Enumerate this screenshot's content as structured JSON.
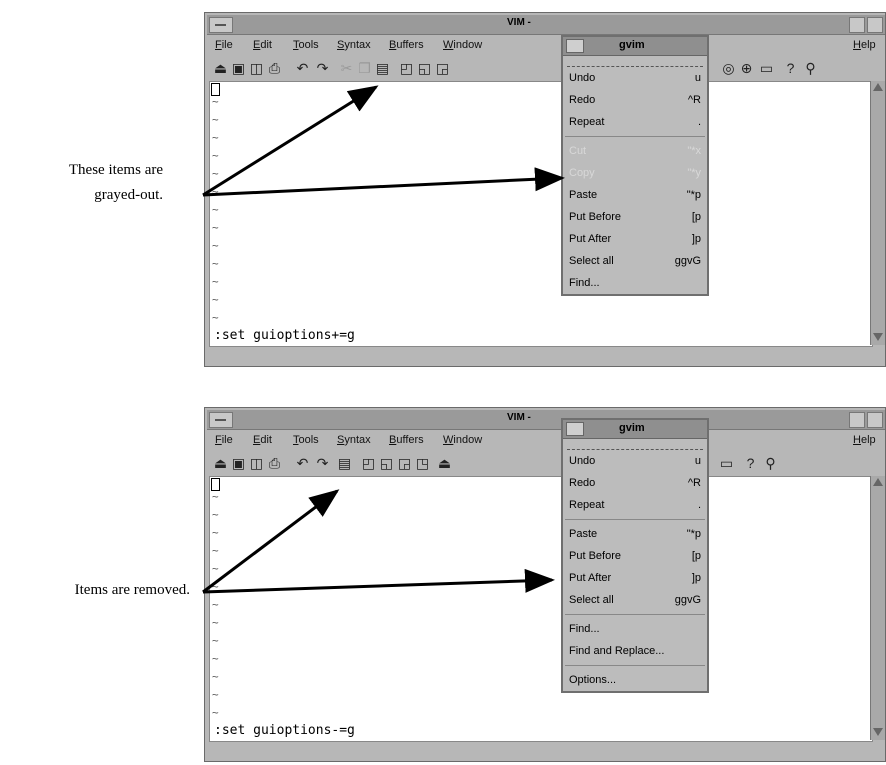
{
  "top": {
    "caption_line1": "These items are",
    "caption_line2": "grayed-out.",
    "window_title": "VIM -",
    "menus": [
      {
        "pre": "",
        "acc": "F",
        "post": "ile"
      },
      {
        "pre": "",
        "acc": "E",
        "post": "dit"
      },
      {
        "pre": "",
        "acc": "T",
        "post": "ools"
      },
      {
        "pre": "",
        "acc": "S",
        "post": "yntax"
      },
      {
        "pre": "",
        "acc": "B",
        "post": "uffers"
      },
      {
        "pre": "",
        "acc": "W",
        "post": "indow"
      },
      {
        "pre": "",
        "acc": "H",
        "post": "elp"
      }
    ],
    "menu_title": "gvim",
    "menu_items": [
      {
        "label": "Undo",
        "shortcut": "u",
        "grayed": false
      },
      {
        "label": "Redo",
        "shortcut": "^R",
        "grayed": false
      },
      {
        "label": "Repeat",
        "shortcut": ".",
        "grayed": false
      },
      {
        "label": "Cut",
        "shortcut": "\"*x",
        "grayed": true
      },
      {
        "label": "Copy",
        "shortcut": "\"*y",
        "grayed": true
      },
      {
        "label": "Paste",
        "shortcut": "\"*p",
        "grayed": false
      },
      {
        "label": "Put Before",
        "shortcut": "[p",
        "grayed": false
      },
      {
        "label": "Put After",
        "shortcut": "]p",
        "grayed": false
      },
      {
        "label": "Select all",
        "shortcut": "ggvG",
        "grayed": false
      },
      {
        "label": "Find...",
        "shortcut": "",
        "grayed": false
      }
    ],
    "command_line": ":set guioptions+=g"
  },
  "bottom": {
    "caption": "Items are removed.",
    "window_title": "VIM -",
    "menu_title": "gvim",
    "menu_items": [
      {
        "label": "Undo",
        "shortcut": "u"
      },
      {
        "label": "Redo",
        "shortcut": "^R"
      },
      {
        "label": "Repeat",
        "shortcut": "."
      },
      {
        "label": "Paste",
        "shortcut": "\"*p"
      },
      {
        "label": "Put Before",
        "shortcut": "[p"
      },
      {
        "label": "Put After",
        "shortcut": "]p"
      },
      {
        "label": "Select all",
        "shortcut": "ggvG"
      },
      {
        "label": "Find...",
        "shortcut": ""
      },
      {
        "label": "Find and Replace...",
        "shortcut": ""
      },
      {
        "label": "Options...",
        "shortcut": ""
      }
    ],
    "command_line": ":set guioptions-=g"
  },
  "toolbar_icons": [
    "open-icon",
    "save-icon",
    "save-all-icon",
    "print-icon",
    "undo-icon",
    "redo-icon",
    "cut-icon",
    "copy-icon",
    "paste-icon",
    "find-icon",
    "find-next-icon",
    "find-prev-icon",
    "replace-icon",
    "run-icon",
    "make-icon",
    "tags-icon",
    "help-icon",
    "find-help-icon"
  ]
}
